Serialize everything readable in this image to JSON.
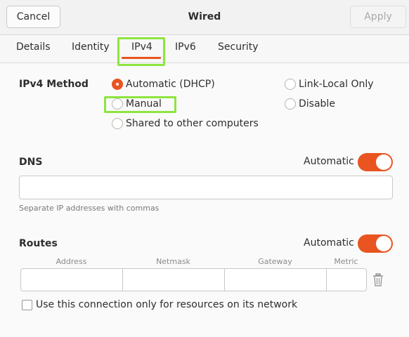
{
  "header": {
    "title": "Wired",
    "cancel_label": "Cancel",
    "apply_label": "Apply"
  },
  "tabs": [
    {
      "label": "Details",
      "selected": false
    },
    {
      "label": "Identity",
      "selected": false
    },
    {
      "label": "IPv4",
      "selected": true
    },
    {
      "label": "IPv6",
      "selected": false
    },
    {
      "label": "Security",
      "selected": false
    }
  ],
  "ipv4_method": {
    "label": "IPv4 Method",
    "options": [
      {
        "label": "Automatic (DHCP)",
        "checked": true
      },
      {
        "label": "Manual",
        "checked": false
      },
      {
        "label": "Shared to other computers",
        "checked": false
      },
      {
        "label": "Link-Local Only",
        "checked": false
      },
      {
        "label": "Disable",
        "checked": false
      }
    ]
  },
  "dns": {
    "label": "DNS",
    "automatic_label": "Automatic",
    "automatic_on": true,
    "value": "",
    "hint": "Separate IP addresses with commas"
  },
  "routes": {
    "label": "Routes",
    "automatic_label": "Automatic",
    "automatic_on": true,
    "columns": [
      "Address",
      "Netmask",
      "Gateway",
      "Metric"
    ],
    "row": {
      "address": "",
      "netmask": "",
      "gateway": "",
      "metric": ""
    },
    "only_local_label": "Use this connection only for resources on its network",
    "only_local_checked": false
  },
  "colors": {
    "accent": "#e95420",
    "highlight": "#8ee53f"
  }
}
